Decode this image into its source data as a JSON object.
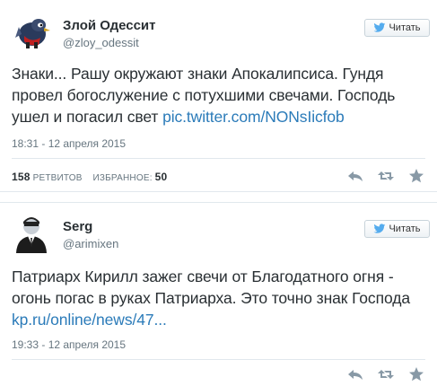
{
  "tweets": [
    {
      "display_name": "Злой Одессит",
      "screen_name": "@zloy_odessit",
      "follow_label": "Читать",
      "text": "Знаки... Рашу окружают знаки Апокалипсиса. Гундя провел богослужение с потухшими свечами. Господь ушел и погасил свет",
      "link": "pic.twitter.com/NONsIicfob",
      "timestamp": "18:31 - 12 апреля 2015",
      "retweets_count": "158",
      "retweets_label": "ретвитов",
      "favorites_label": "избранное:",
      "favorites_count": "50"
    },
    {
      "display_name": "Serg",
      "screen_name": "@arimixen",
      "follow_label": "Читать",
      "text": "Патриарх Кирилл зажег свечи от Благодатного огня - огонь погас в руках Патриарха. Это точно знак Господа",
      "link": "kp.ru/online/news/47...",
      "timestamp": "19:33 - 12 апреля 2015"
    }
  ],
  "icons": {
    "follow": "twitter-bird-icon",
    "reply": "reply-icon",
    "retweet": "retweet-icon",
    "favorite": "star-icon"
  },
  "colors": {
    "link": "#2b7bb9",
    "muted": "#66757f",
    "twitter_blue": "#55acee"
  }
}
